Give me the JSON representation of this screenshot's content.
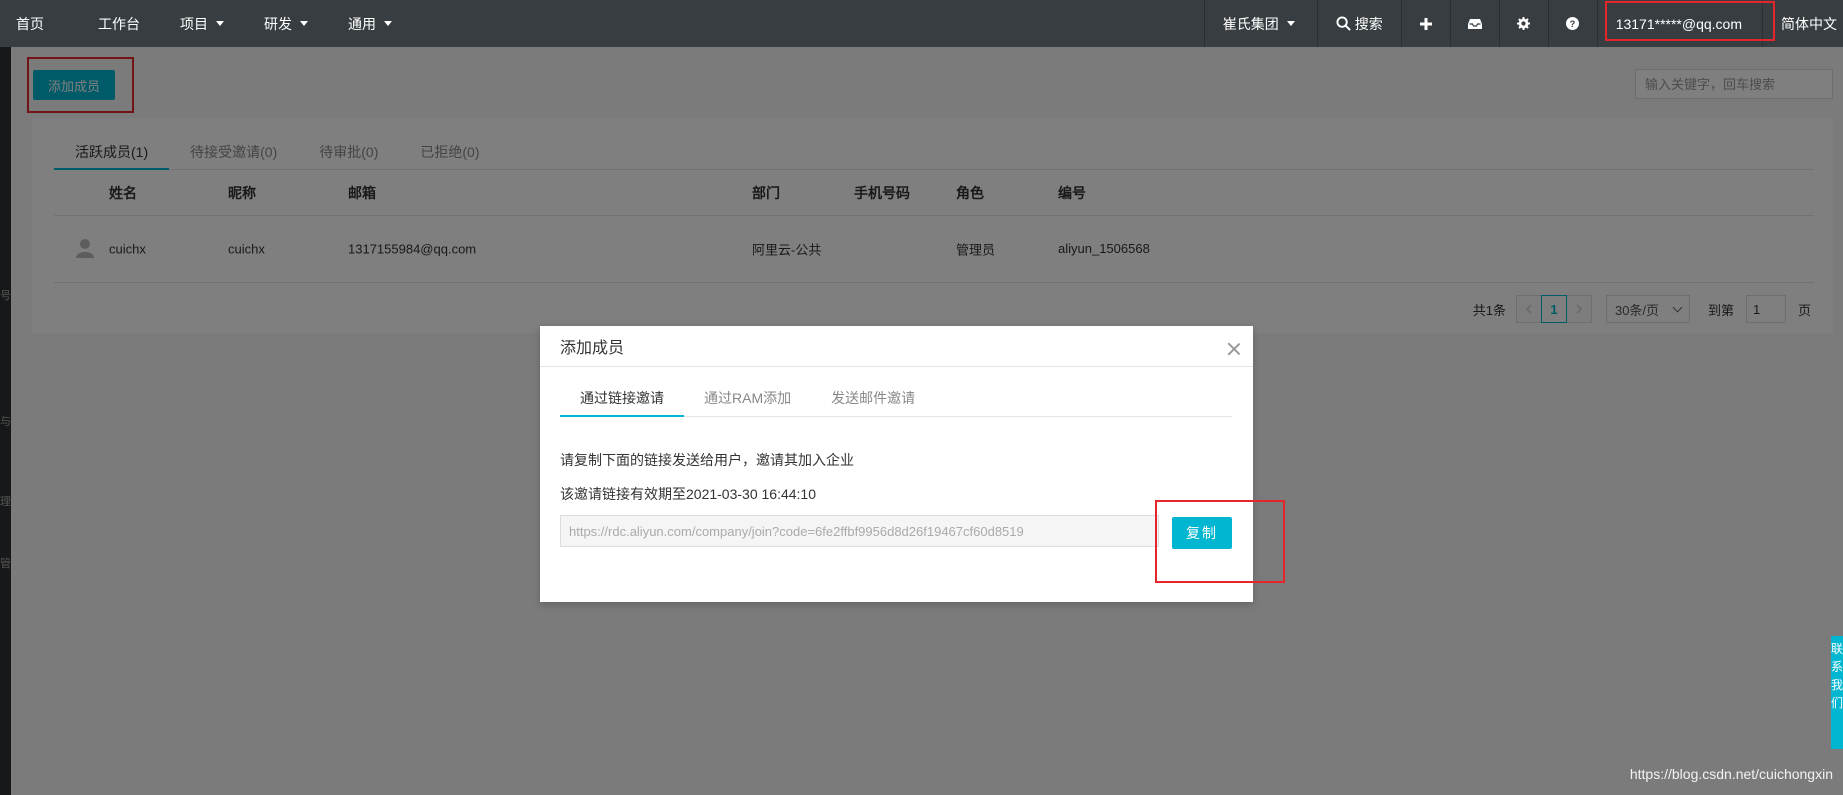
{
  "nav": {
    "items": [
      {
        "label": "首页",
        "caret": false
      },
      {
        "label": "工作台",
        "caret": false
      },
      {
        "label": "项目",
        "caret": true
      },
      {
        "label": "研发",
        "caret": true
      },
      {
        "label": "通用",
        "caret": true
      }
    ],
    "org": "崔氏集团",
    "search": "搜索",
    "account": "13171*****@qq.com",
    "language": "简体中文"
  },
  "sidebar_fragments": [
    "号",
    "与",
    "理",
    "管"
  ],
  "toolbar": {
    "add_member": "添加成员",
    "search_placeholder": "输入关键字，回车搜索"
  },
  "member_tabs": [
    "活跃成员(1)",
    "待接受邀请(0)",
    "待审批(0)",
    "已拒绝(0)"
  ],
  "table": {
    "headers": [
      "姓名",
      "昵称",
      "邮箱",
      "部门",
      "手机号码",
      "角色",
      "编号"
    ],
    "rows": [
      {
        "name": "cuichx",
        "nickname": "cuichx",
        "email": "1317155984@qq.com",
        "dept": "阿里云-公共",
        "phone": "",
        "role": "管理员",
        "code": "aliyun_1506568"
      }
    ]
  },
  "pagination": {
    "total": "共1条",
    "current_page": "1",
    "page_size": "30条/页",
    "goto_label": "到第",
    "goto_value": "1",
    "page_unit": "页"
  },
  "modal": {
    "title": "添加成员",
    "tabs": [
      "通过链接邀请",
      "通过RAM添加",
      "发送邮件邀请"
    ],
    "instruction": "请复制下面的链接发送给用户，邀请其加入企业",
    "expiry": "该邀请链接有效期至2021-03-30 16:44:10",
    "link": "https://rdc.aliyun.com/company/join?code=6fe2ffbf9956d8d26f19467cf60d8519",
    "copy_label": "复制"
  },
  "feedback_chars": [
    "联",
    "系",
    "我",
    "们"
  ],
  "watermark": "https://blog.csdn.net/cuichongxin",
  "colors": {
    "accent": "#00b6d0",
    "highlight": "#e4262c",
    "topbar": "#373d41"
  }
}
